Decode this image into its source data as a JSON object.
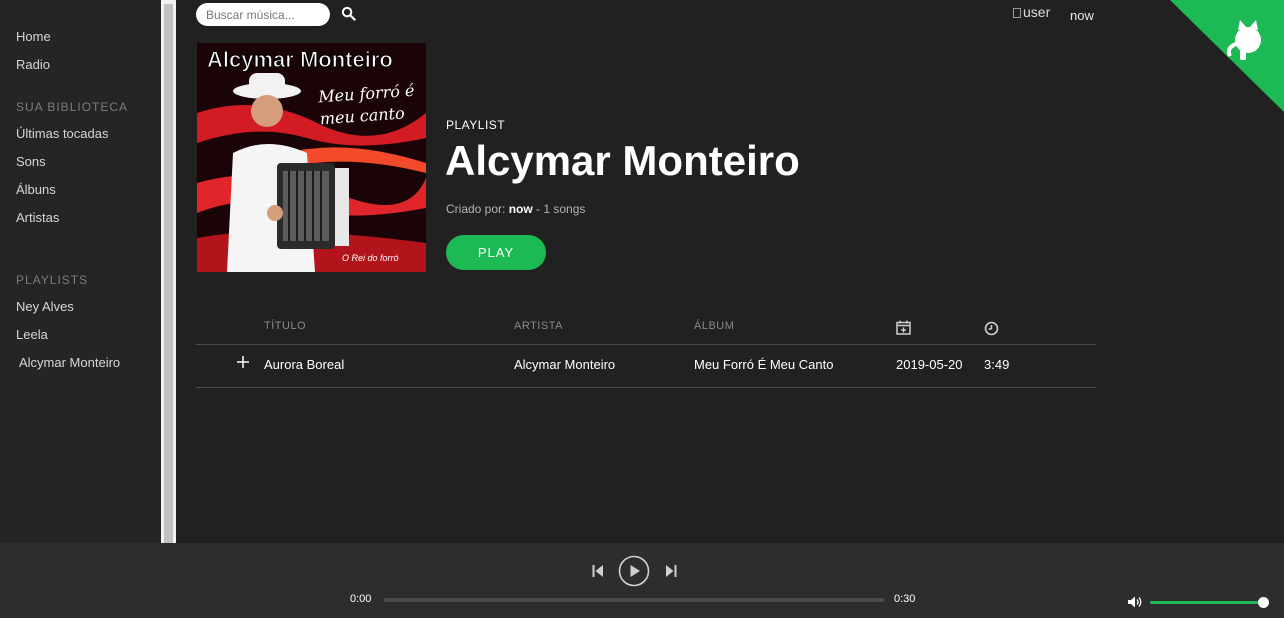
{
  "sidebar": {
    "nav": [
      "Home",
      "Radio"
    ],
    "library_heading": "SUA BIBLIOTECA",
    "library": [
      "Últimas tocadas",
      "Sons",
      "Álbuns",
      "Artistas"
    ],
    "playlists_heading": "PLAYLISTS",
    "playlists": [
      "Ney Alves",
      "Leela",
      "Alcymar Monteiro"
    ]
  },
  "header": {
    "search_placeholder": "Buscar música...",
    "user_img_alt": "user",
    "user_name": "now"
  },
  "cover": {
    "title": "Alcymar Monteiro",
    "subtitle_line1": "Meu forró é",
    "subtitle_line2": "meu canto",
    "small_text": "O Rei do forró"
  },
  "playlist": {
    "label": "PLAYLIST",
    "title": "Alcymar Monteiro",
    "created_by_prefix": "Criado por: ",
    "created_by": "now",
    "songs_suffix": " - 1 songs",
    "play_label": "PLAY"
  },
  "table": {
    "headers": {
      "title": "TÍTULO",
      "artist": "ARTISTA",
      "album": "ÁLBUM"
    },
    "rows": [
      {
        "title": "Aurora Boreal",
        "artist": "Alcymar Monteiro",
        "album": "Meu Forró É Meu Canto",
        "date": "2019-05-20",
        "duration": "3:49"
      }
    ]
  },
  "player": {
    "current_time": "0:00",
    "total_time": "0:30",
    "progress": 0,
    "volume": 1.0
  },
  "colors": {
    "accent": "#1db954",
    "background": "#222122",
    "sidebar": "#252525",
    "player": "#2d2d2d"
  },
  "icons": {
    "search": "search-icon",
    "add": "plus-icon",
    "date": "calendar-add-icon",
    "duration": "clock-icon",
    "prev": "skip-back-icon",
    "play": "play-circle-icon",
    "next": "skip-forward-icon",
    "volume": "volume-icon",
    "corner": "github-octocat-icon"
  }
}
